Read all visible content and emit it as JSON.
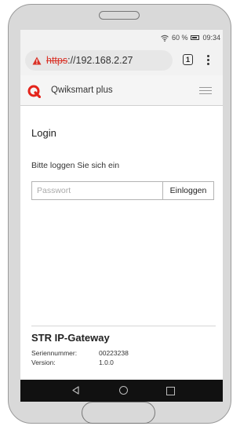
{
  "status_bar": {
    "signal": "60 %",
    "time": "09:34"
  },
  "browser": {
    "url_scheme": "https",
    "url_rest": "://192.168.2.27",
    "tab_count": "1"
  },
  "app": {
    "name": "Qwiksmart plus",
    "brand_color": "#e4241b"
  },
  "login": {
    "title": "Login",
    "subtitle": "Bitte loggen Sie sich ein",
    "password_placeholder": "Passwort",
    "password_value": "",
    "button_label": "Einloggen"
  },
  "gateway": {
    "title": "STR IP-Gateway",
    "serial_label": "Seriennummer:",
    "serial_value": "00223238",
    "version_label": "Version:",
    "version_value": "1.0.0"
  },
  "icons": {
    "status": [
      "wifi-icon",
      "battery-icon"
    ],
    "browser": [
      "warning-icon",
      "tab-count-icon",
      "menu-dots-icon"
    ],
    "app": [
      "qwiksmart-logo-icon",
      "hamburger-icon"
    ],
    "nav": [
      "back-icon",
      "home-icon",
      "recent-apps-icon"
    ]
  }
}
